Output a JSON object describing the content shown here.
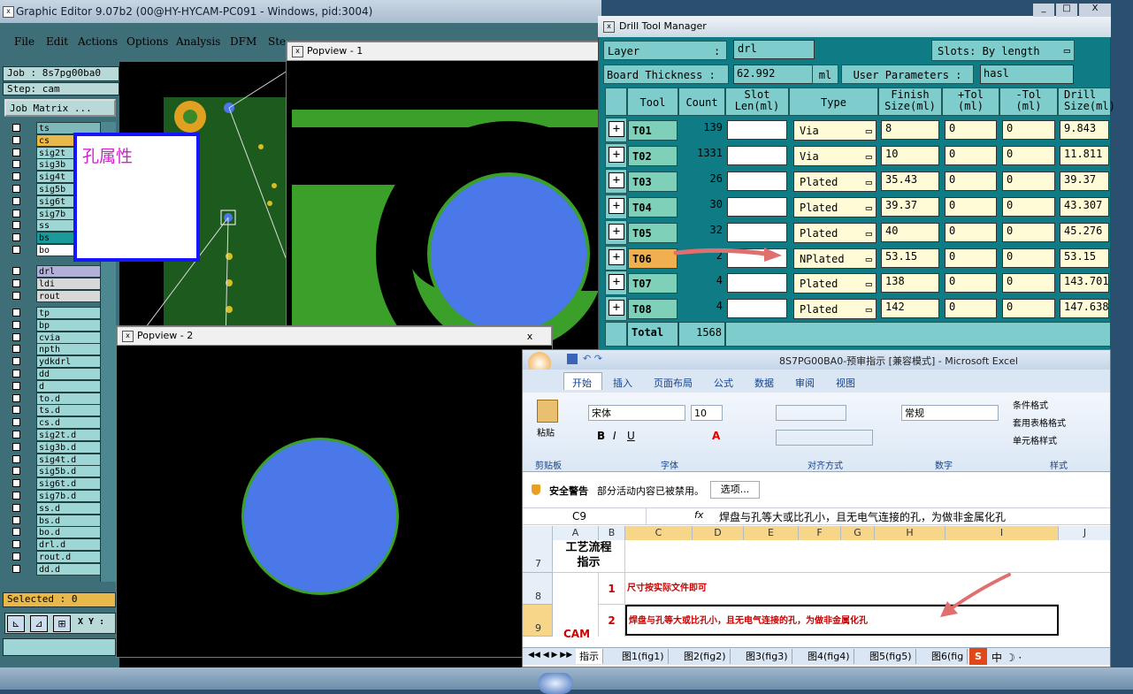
{
  "genesis": {
    "title": "Graphic Editor 9.07b2 (00@HY-HYCAM-PC091 - Windows, pid:3004)",
    "menu": [
      "File",
      "Edit",
      "Actions",
      "Options",
      "Analysis",
      "DFM",
      "Ste"
    ],
    "job_label": "Job : 8s7pg00ba0",
    "step_label": "Step: cam",
    "job_matrix": "Job Matrix ...",
    "layers_board": [
      "ts",
      "cs",
      "sig2t",
      "sig3b",
      "sig4t",
      "sig5b",
      "sig6t",
      "sig7b",
      "ss",
      "bs",
      "bo"
    ],
    "layers_drill": [
      "drl",
      "ldi",
      "rout"
    ],
    "layers_misc": [
      "tp",
      "bp",
      "cvia",
      "npth",
      "ydkdrl",
      "dd",
      "d",
      "to.d",
      "ts.d",
      "cs.d",
      "sig2t.d",
      "sig3b.d",
      "sig4t.d",
      "sig5b.d",
      "sig6t.d",
      "sig7b.d",
      "ss.d",
      "bs.d",
      "bo.d",
      "drl.d",
      "rout.d",
      "dd.d"
    ],
    "selected": "Selected : 0",
    "xy_label": "X Y :",
    "note_text": "孔属性"
  },
  "popview1": {
    "title": "Popview - 1"
  },
  "popview2": {
    "title": "Popview - 2",
    "close": "x"
  },
  "dtm": {
    "title": "Drill Tool Manager",
    "layer_label": "Layer",
    "layer_colon": ":",
    "layer_value": "drl",
    "slots_label": "Slots:",
    "slots_value": "By length",
    "thickness_label": "Board Thickness :",
    "thickness_value": "62.992",
    "thickness_unit": "ml",
    "userparam_label": "User Parameters :",
    "userparam_value": "hasl",
    "headers": [
      "Tool",
      "Count",
      "Slot\nLen(ml)",
      "Type",
      "Finish\nSize(ml)",
      "+Tol\n(ml)",
      "-Tol\n(ml)",
      "Drill\nSize(ml)"
    ],
    "rows": [
      {
        "tool": "T01",
        "count": "139",
        "type": "Via",
        "finish": "8",
        "ptol": "0",
        "ntol": "0",
        "drill": "9.843"
      },
      {
        "tool": "T02",
        "count": "1331",
        "type": "Via",
        "finish": "10",
        "ptol": "0",
        "ntol": "0",
        "drill": "11.811"
      },
      {
        "tool": "T03",
        "count": "26",
        "type": "Plated",
        "finish": "35.43",
        "ptol": "0",
        "ntol": "0",
        "drill": "39.37"
      },
      {
        "tool": "T04",
        "count": "30",
        "type": "Plated",
        "finish": "39.37",
        "ptol": "0",
        "ntol": "0",
        "drill": "43.307"
      },
      {
        "tool": "T05",
        "count": "32",
        "type": "Plated",
        "finish": "40",
        "ptol": "0",
        "ntol": "0",
        "drill": "45.276"
      },
      {
        "tool": "T06",
        "count": "2",
        "type": "NPlated",
        "finish": "53.15",
        "ptol": "0",
        "ntol": "0",
        "drill": "53.15"
      },
      {
        "tool": "T07",
        "count": "4",
        "type": "Plated",
        "finish": "138",
        "ptol": "0",
        "ntol": "0",
        "drill": "143.701"
      },
      {
        "tool": "T08",
        "count": "4",
        "type": "Plated",
        "finish": "142",
        "ptol": "0",
        "ntol": "0",
        "drill": "147.638"
      }
    ],
    "total_label": "Total",
    "total_value": "1568"
  },
  "excel": {
    "title": "8S7PG00BA0-预审指示 [兼容模式] - Microsoft Excel",
    "tabs": [
      "开始",
      "插入",
      "页面布局",
      "公式",
      "数据",
      "审阅",
      "视图"
    ],
    "paste": "粘贴",
    "font_name": "宋体",
    "font_size": "10",
    "number_format": "常规",
    "styles": [
      "条件格式",
      "套用表格格式",
      "单元格样式"
    ],
    "groups": [
      "剪贴板",
      "字体",
      "对齐方式",
      "数字",
      "样式"
    ],
    "security_title": "安全警告",
    "security_text": "部分活动内容已被禁用。",
    "options_btn": "选项...",
    "name_box": "C9",
    "fx": "fx",
    "formula": "焊盘与孔等大或比孔小，且无电气连接的孔，为做非金属化孔",
    "columns": [
      "A",
      "B",
      "C",
      "D",
      "E",
      "F",
      "G",
      "H",
      "I",
      "J"
    ],
    "rows": [
      {
        "num": "7",
        "a": "工艺流程\n指示",
        "b": "",
        "c": ""
      },
      {
        "num": "8",
        "a": "",
        "b": "1",
        "c": "尺寸按实际文件即可"
      },
      {
        "num": "9",
        "a": "",
        "b": "2",
        "c": "焊盘与孔等大或比孔小，且无电气连接的孔，为做非金属化孔"
      }
    ],
    "cam_label": "CAM",
    "sheets": [
      "指示",
      "图1(fig1)",
      "图2(fig2)",
      "图3(fig3)",
      "图4(fig4)",
      "图5(fig5)",
      "图6(fig"
    ]
  },
  "window_controls": [
    "_",
    "□",
    "X"
  ],
  "colors": {
    "dtm_bg": "#0f7b84",
    "cell_yellow": "#fffbd6",
    "pcb_green": "#3aa02a",
    "drill_blue": "#4a78e8",
    "arrow": "#e07070"
  }
}
